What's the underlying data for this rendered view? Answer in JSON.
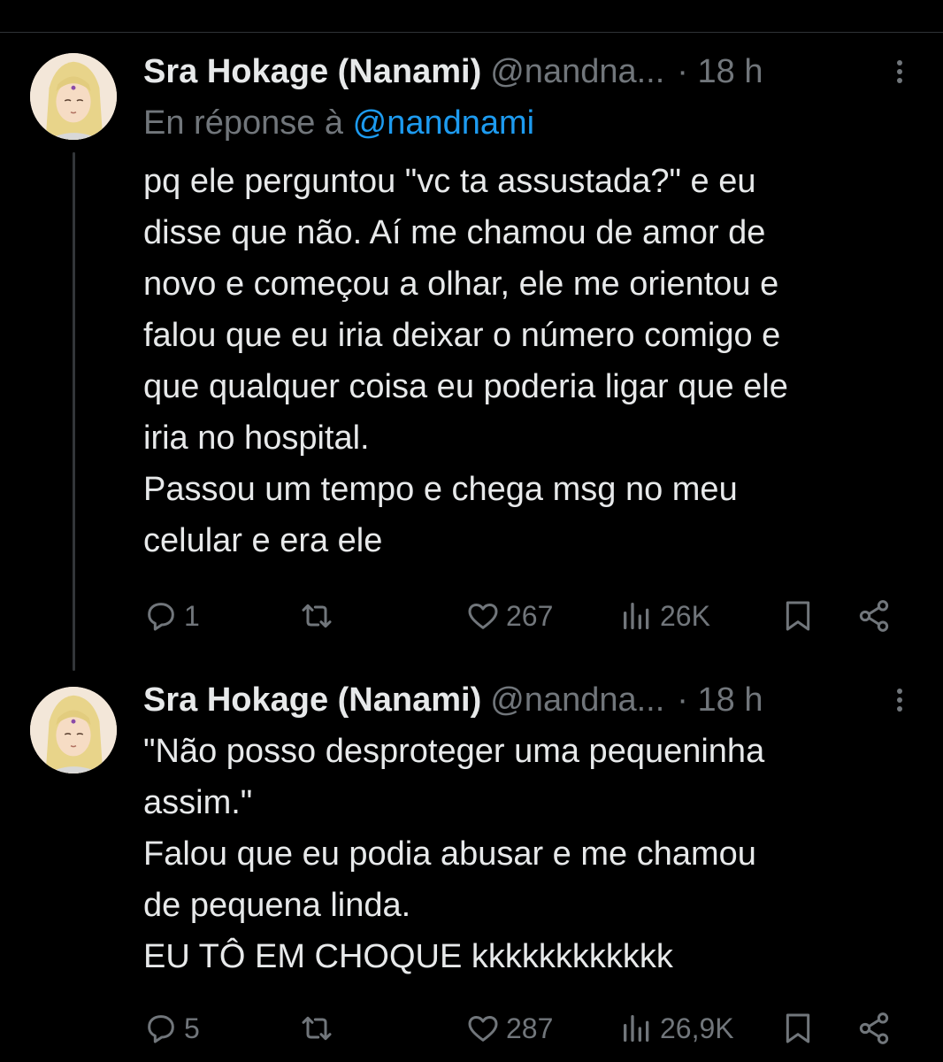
{
  "tweets": [
    {
      "author_name": "Sra Hokage (Nanami)",
      "handle": "@nandna...",
      "time": "· 18 h",
      "reply_prefix": "En réponse à",
      "reply_mention": "@nandnami",
      "lines": [
        "pq ele perguntou \"vc ta assustada?\" e eu",
        "disse que não. Aí me chamou de amor de",
        "novo e começou a olhar, ele me orientou e",
        "falou que eu iria deixar o número comigo e",
        "que qualquer coisa eu poderia ligar que ele",
        "iria no hospital.",
        "Passou um tempo e chega msg no meu",
        "celular e era ele"
      ],
      "replies": "1",
      "retweets": "",
      "likes": "267",
      "views": "26K"
    },
    {
      "author_name": "Sra Hokage (Nanami)",
      "handle": "@nandna...",
      "time": "· 18 h",
      "lines": [
        "\"Não posso desproteger uma pequeninha",
        "assim.\"",
        "Falou que eu podia abusar e me chamou",
        "de pequena linda.",
        "EU TÔ EM CHOQUE kkkkkkkkkkkk"
      ],
      "replies": "5",
      "retweets": "",
      "likes": "287",
      "views": "26,9K"
    }
  ],
  "colors": {
    "background": "#000000",
    "text": "#e7e9ea",
    "muted": "#71767b",
    "link": "#1d9bf0",
    "thread_line": "#333639"
  },
  "icons": [
    "reply-icon",
    "retweet-icon",
    "like-icon",
    "views-icon",
    "bookmark-icon",
    "share-icon",
    "more-icon",
    "avatar"
  ]
}
